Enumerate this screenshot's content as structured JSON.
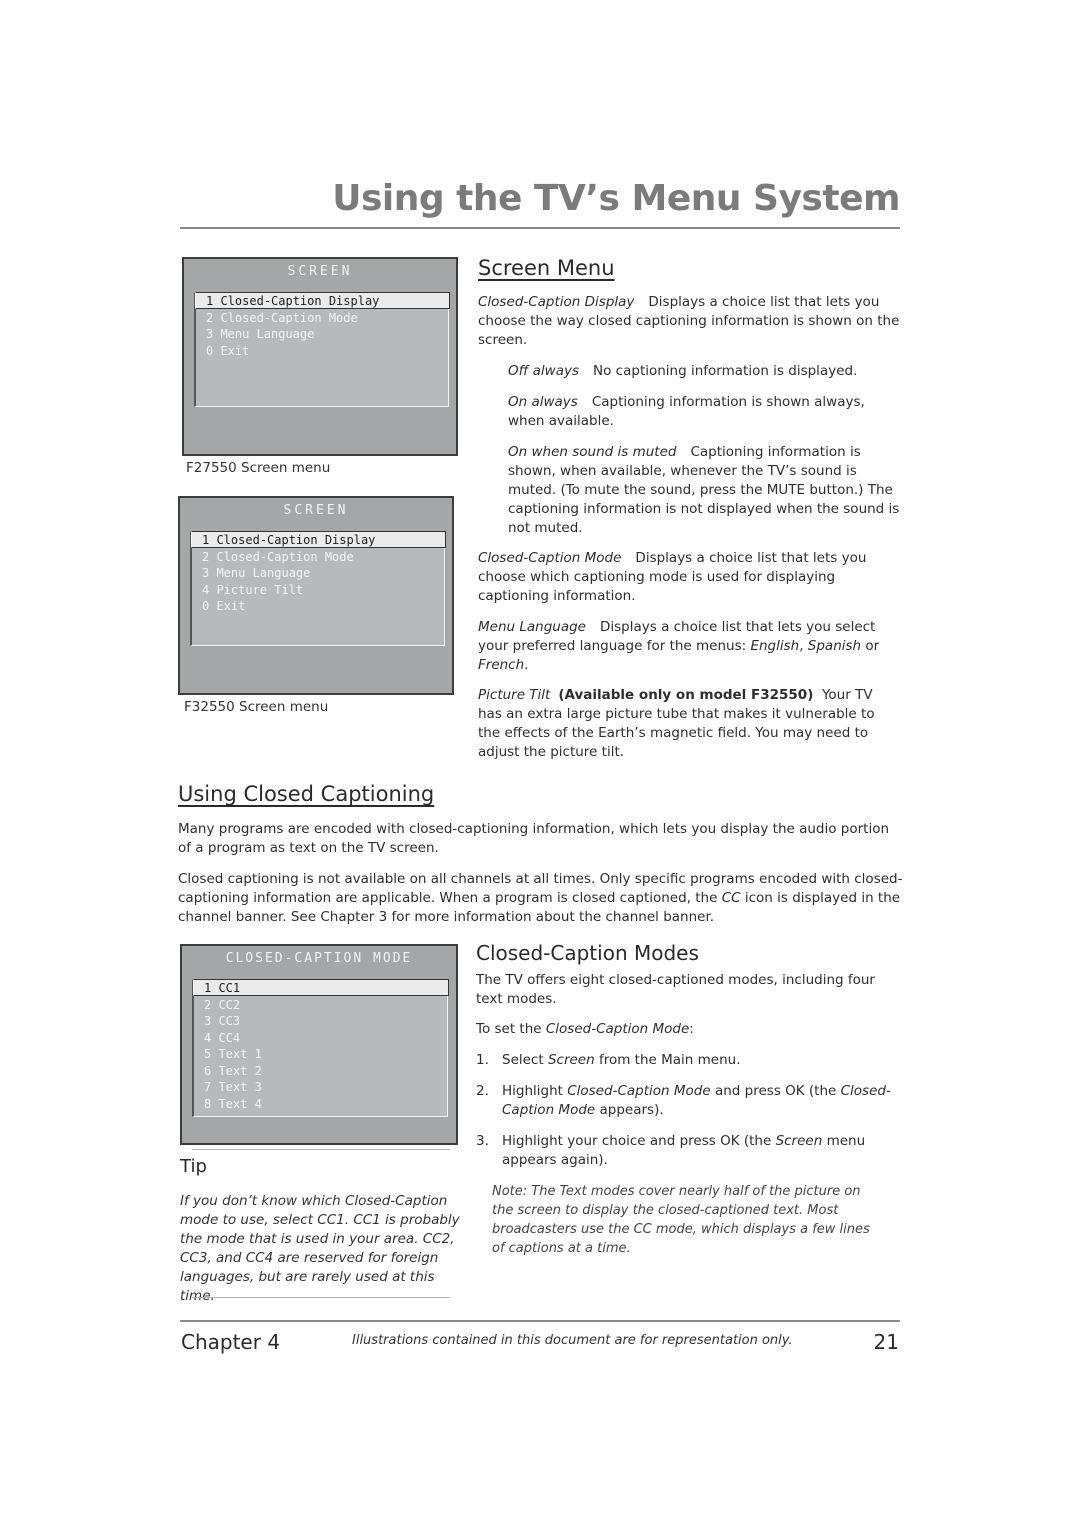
{
  "header": {
    "title": "Using the TV’s Menu System"
  },
  "menus": {
    "f27550": {
      "title": "SCREEN",
      "items": [
        "1 Closed-Caption Display",
        "2 Closed-Caption Mode",
        "3 Menu Language",
        "0 Exit"
      ],
      "selected_index": 0,
      "caption": "F27550 Screen menu"
    },
    "f32550": {
      "title": "SCREEN",
      "items": [
        "1 Closed-Caption Display",
        "2 Closed-Caption Mode",
        "3 Menu Language",
        "4 Picture Tilt",
        "0 Exit"
      ],
      "selected_index": 0,
      "caption": "F32550 Screen menu"
    },
    "cc_mode": {
      "title": "CLOSED-CAPTION MODE",
      "items": [
        "1 CC1",
        "2 CC2",
        "3 CC3",
        "4 CC4",
        "5 Text 1",
        "6 Text 2",
        "7 Text 3",
        "8 Text 4"
      ],
      "selected_index": 0
    }
  },
  "screen_menu": {
    "heading": "Screen Menu",
    "cc_display": {
      "term": "Closed-Caption Display",
      "text": "Displays a choice list that lets you choose the way closed captioning information is shown on the screen."
    },
    "options": [
      {
        "term": "Off always",
        "text": "No captioning information is displayed."
      },
      {
        "term": "On always",
        "text": "Captioning information is shown always, when available."
      },
      {
        "term": "On when sound is muted",
        "text": "Captioning information is shown, when available, whenever the TV’s sound is muted. (To mute the sound, press the MUTE button.) The captioning information is not displayed when the sound is not muted."
      }
    ],
    "cc_mode": {
      "term": "Closed-Caption Mode",
      "text": "Displays a choice list that lets you choose which captioning mode is used for displaying captioning information."
    },
    "menu_language": {
      "term": "Menu Language",
      "text_before": "Displays a choice list that lets you select your preferred language for the menus: ",
      "lang1": "English",
      "sep1": ", ",
      "lang2": "Spanish",
      "sep2": " or ",
      "lang3": "French",
      "end": "."
    },
    "picture_tilt": {
      "term": "Picture Tilt",
      "bold": "(Available only on model F32550)",
      "text": "Your TV has an extra large picture tube that makes it vulnerable to the effects of the Earth’s magnetic field. You may need to adjust the picture tilt."
    }
  },
  "closed_captioning": {
    "heading": "Using Closed Captioning",
    "para1": "Many programs are encoded with closed-captioning information, which lets you display the audio portion of a program as text on the TV screen.",
    "para2_before": "Closed captioning is not available on all channels at all times. Only specific programs encoded with closed-captioning information are applicable. When a program is closed captioned, the ",
    "para2_icon": "CC",
    "para2_after": " icon is displayed in the channel banner. See Chapter 3 for more information about the channel banner."
  },
  "cc_modes": {
    "heading": "Closed-Caption Modes",
    "intro": "The TV offers eight closed-captioned modes, including four text modes.",
    "to_set_before": "To set the ",
    "to_set_term": "Closed-Caption Mode",
    "to_set_after": ":",
    "steps": [
      {
        "num": "1.",
        "parts": [
          [
            "",
            "Select "
          ],
          [
            "i",
            "Screen"
          ],
          [
            "",
            " from the Main menu."
          ]
        ]
      },
      {
        "num": "2.",
        "parts": [
          [
            "",
            "Highlight "
          ],
          [
            "i",
            "Closed-Caption Mode"
          ],
          [
            "",
            " and press OK  (the "
          ],
          [
            "i",
            "Closed-Caption Mode"
          ],
          [
            "",
            " appears)."
          ]
        ]
      },
      {
        "num": "3.",
        "parts": [
          [
            "",
            "Highlight your choice and press OK (the "
          ],
          [
            "i",
            "Screen"
          ],
          [
            "",
            " menu appears again)."
          ]
        ]
      }
    ],
    "note": "Note: The Text modes cover nearly half of the picture on the screen to display the closed-captioned text. Most broadcasters use the CC mode, which displays a few lines of captions at a time."
  },
  "tip": {
    "heading": "Tip",
    "text": "If you don’t know which Closed-Caption mode to use, select CC1. CC1 is probably the mode that is used in your area. CC2, CC3, and CC4  are reserved for foreign languages, but are rarely used at this time."
  },
  "footer": {
    "chapter": "Chapter 4",
    "note": "Illustrations contained in this document are for representation only.",
    "page": "21"
  }
}
